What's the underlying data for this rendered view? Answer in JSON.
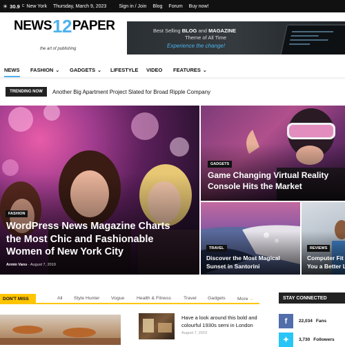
{
  "topbar": {
    "temperature": "30.9",
    "degree": "C",
    "city": "New York",
    "date": "Thursday, March 9, 2023",
    "links": [
      "Sign in / Join",
      "Blog",
      "Forum",
      "Buy now!"
    ]
  },
  "header": {
    "logo_part1": "NEWS",
    "logo_part2": "12",
    "logo_part3": "PAPER",
    "tagline": "the art of publishing",
    "banner_line1_a": "Best Selling ",
    "banner_line1_b": "BLOG",
    "banner_line1_c": " and ",
    "banner_line1_d": "MAGAZINE",
    "banner_line2": "Theme of All Time",
    "banner_line3": "Experience the change!"
  },
  "nav": {
    "items": [
      {
        "label": "NEWS"
      },
      {
        "label": "FASHION"
      },
      {
        "label": "GADGETS"
      },
      {
        "label": "LIFESTYLE"
      },
      {
        "label": "VIDEO"
      },
      {
        "label": "FEATURES"
      }
    ]
  },
  "trending": {
    "label": "TRENDING NOW",
    "headline": "Another Big Apartment Project Slated for Broad Ripple Company"
  },
  "hero": {
    "main": {
      "tag": "FASHION",
      "title_lines": [
        "WordPress News Magazine Charts",
        "the Most Chic and Fashionable",
        "Women of New York City"
      ],
      "author": "Armin Vans",
      "date": "- August 7, 2019"
    },
    "top_right": {
      "tag": "GADGETS",
      "title_lines": [
        "Game Changing Virtual Reality",
        "Console Hits the Market"
      ]
    },
    "bottom_left": {
      "tag": "TRAVEL",
      "title_lines": [
        "Discover the Most Magical",
        "Sunset in Santorini"
      ]
    },
    "bottom_right": {
      "tag": "REVIEWS",
      "title_lines": [
        "Computer Fit",
        "You a Better L"
      ]
    }
  },
  "dont_miss": {
    "label": "DON'T MISS",
    "tabs": [
      "All",
      "Style Hunter",
      "Vogue",
      "Health & Fitness",
      "Travel",
      "Gadgets",
      "More"
    ],
    "article_title": "Have a look around this bold and colourful 1930s semi in London",
    "article_date": "August 7, 2019"
  },
  "stay_connected": {
    "label": "STAY CONNECTED",
    "facebook_count": "22,034",
    "facebook_label": "Fans",
    "twitter_count": "3,730",
    "twitter_label": "Followers",
    "facebook_color": "#516eab",
    "twitter_color": "#29c5f6"
  },
  "colors": {
    "accent": "#4db2ec",
    "dont_miss": "#ffc500"
  }
}
